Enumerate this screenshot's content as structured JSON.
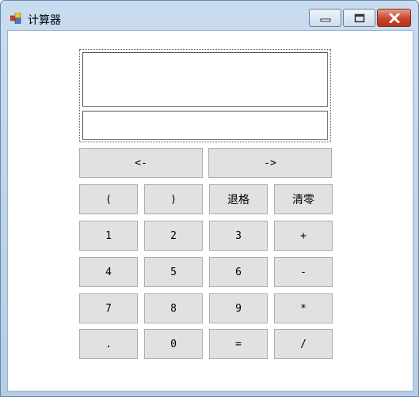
{
  "window": {
    "title": "计算器",
    "icons": [
      "app-icon",
      "minimize-icon",
      "maximize-icon",
      "close-icon"
    ]
  },
  "display": {
    "expression": "",
    "result": ""
  },
  "cursor_row": {
    "left_label": "<-",
    "right_label": "->"
  },
  "keypad": {
    "rows": [
      [
        "(",
        ")",
        "退格",
        "清零"
      ],
      [
        "1",
        "2",
        "3",
        "+"
      ],
      [
        "4",
        "5",
        "6",
        "-"
      ],
      [
        "7",
        "8",
        "9",
        "*"
      ],
      [
        ".",
        "0",
        "=",
        "/"
      ]
    ]
  },
  "colors": {
    "button_face": "#e1e1e1",
    "button_border": "#adadad",
    "frame": "#b5cde6",
    "close_button": "#c6462c"
  }
}
